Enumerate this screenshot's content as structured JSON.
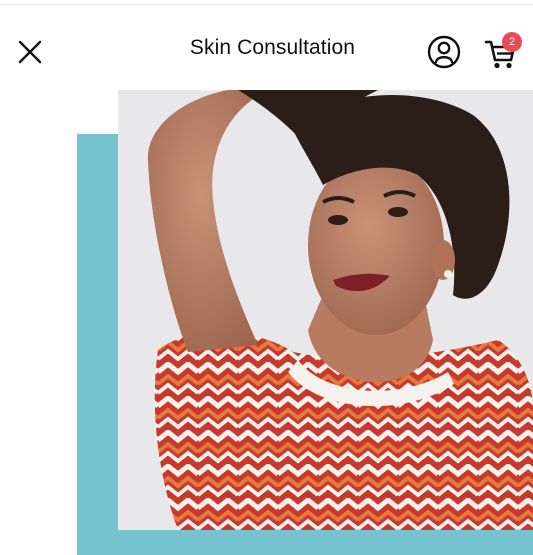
{
  "header": {
    "title": "Skin Consultation",
    "cart_count": "2"
  },
  "icons": {
    "close": "close-icon",
    "account": "user-icon",
    "cart": "cart-icon"
  },
  "colors": {
    "accent_teal": "#75c3cf",
    "badge_red": "#e94b55",
    "text": "#111111"
  }
}
